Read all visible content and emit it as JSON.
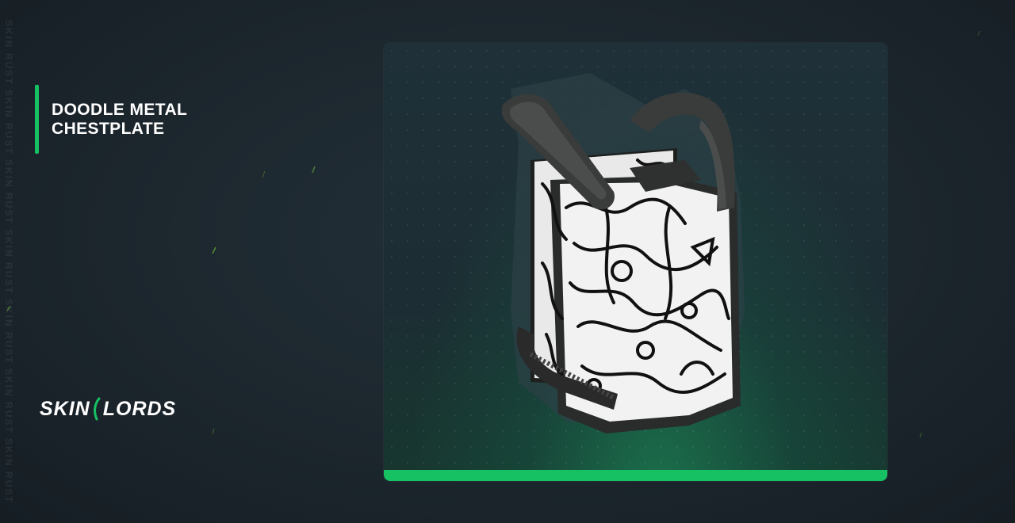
{
  "item": {
    "title_line1": "DOODLE METAL",
    "title_line2": "CHESTPLATE",
    "image_icon": "doodle-metal-chestplate-icon"
  },
  "brand": {
    "part1": "SKIN",
    "part2": "LORDS",
    "accent_color": "#16c163"
  },
  "watermark": {
    "text": "SKIN RUST SKIN RUST SKIN RUST SKIN RUST SKIN RUST SKIN RUST SKIN RUST"
  },
  "colors": {
    "accent": "#16c163",
    "background": "#1c262d",
    "card": "#1f3038"
  }
}
